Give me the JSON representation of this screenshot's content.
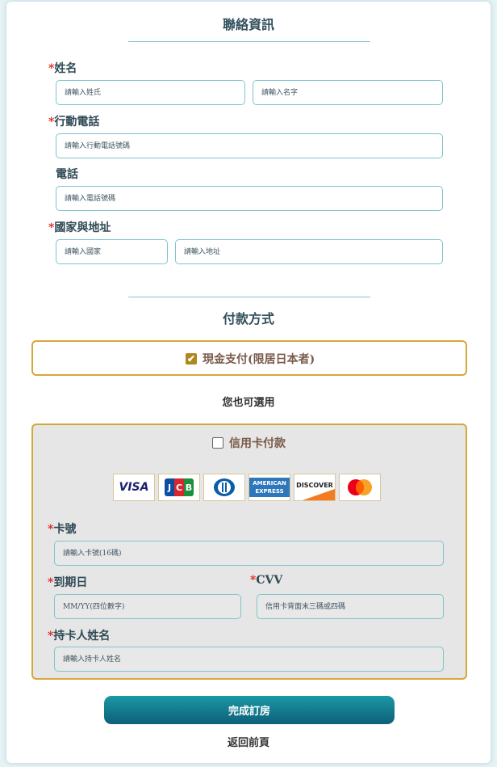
{
  "contact": {
    "title": "聯絡資訊",
    "name_label": "姓名",
    "lastname_placeholder": "請輸入姓氏",
    "firstname_placeholder": "請輸入名字",
    "mobile_label": "行動電話",
    "mobile_placeholder": "請輸入行動電話號碼",
    "phone_label": "電話",
    "phone_placeholder": "請輸入電話號碼",
    "address_label": "國家與地址",
    "country_placeholder": "請輸入國家",
    "address_placeholder": "請輸入地址",
    "required_mark": "*"
  },
  "payment": {
    "title": "付款方式",
    "cash_label": "現金支付(限居日本者)",
    "cash_checked": true,
    "or_text": "您也可選用",
    "credit_label": "信用卡付款",
    "credit_checked": false,
    "card_brands": {
      "visa": "VISA",
      "jcb": "JCB",
      "amex_top": "AMERICAN",
      "amex_bottom": "EXPRESS",
      "discover": "DISCOVER"
    },
    "card_number_label": "卡號",
    "card_number_placeholder": "請輸入卡號(16碼)",
    "expiry_label": "到期日",
    "expiry_placeholder": "MM/YY(四位數字)",
    "cvv_label": "CVV",
    "cvv_placeholder": "信用卡背面末三碼或四碼",
    "holder_label": "持卡人姓名",
    "holder_placeholder": "請輸入持卡人姓名"
  },
  "actions": {
    "submit": "完成訂房",
    "back": "返回前頁"
  },
  "colors": {
    "accent_border": "#d6a73a",
    "input_border": "#7fc3cf",
    "button_top": "#1b98a6",
    "button_bottom": "#0d5f78",
    "required": "#e0201a"
  }
}
